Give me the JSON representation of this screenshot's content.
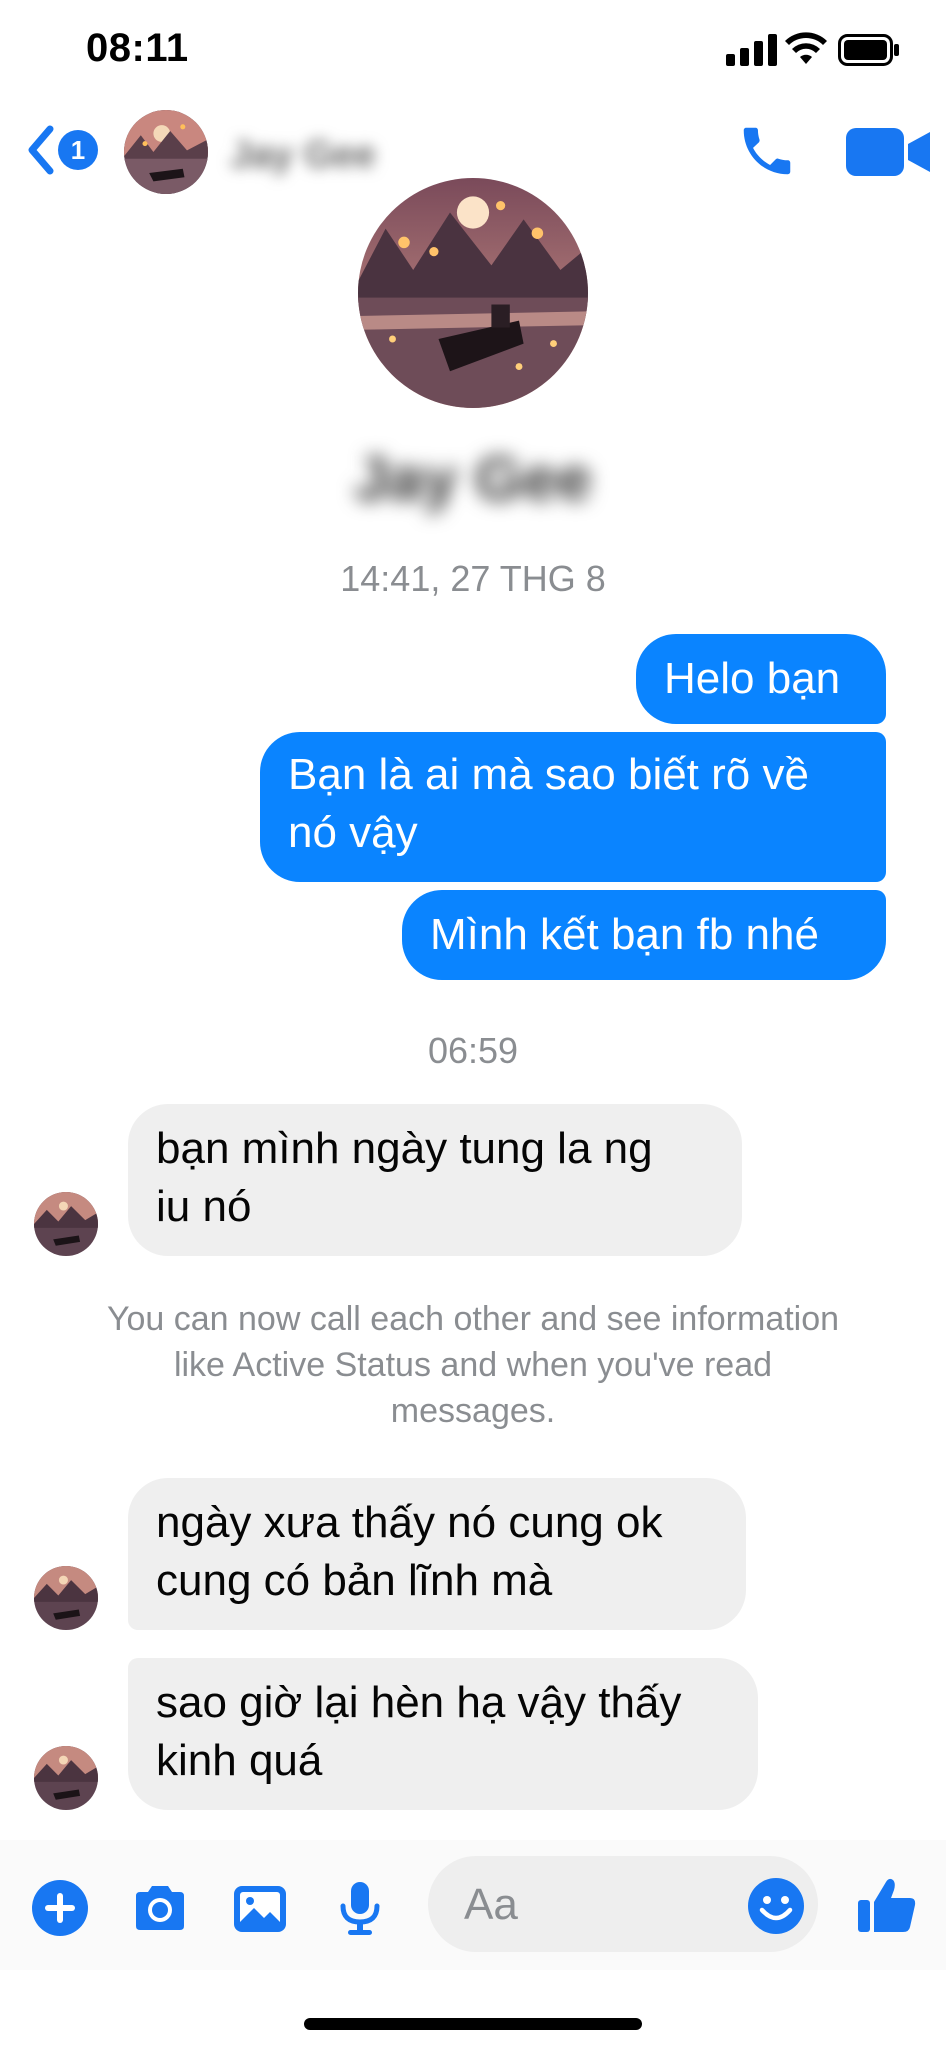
{
  "status_bar": {
    "time": "08:11"
  },
  "header": {
    "back_badge": "1",
    "contact_name": "Jay Gee"
  },
  "profile": {
    "name": "Jay Gee"
  },
  "timestamps": {
    "first": "14:41, 27 THG 8",
    "second": "06:59"
  },
  "messages": {
    "out_1": "Helo bạn",
    "out_2_line1": "Bạn là ai mà sao biết rõ về",
    "out_2_line2": "nó vậy",
    "out_3": "Mình kết bạn fb nhé",
    "in_1_line1": "bạn mình ngày tung la ng",
    "in_1_line2": "iu nó",
    "in_2_line1": "ngày xưa thấy nó cung ok",
    "in_2_line2": "cung có bản lĩnh mà",
    "in_3_line1": "sao giờ lại hèn hạ vậy thấy",
    "in_3_line2": "kinh quá"
  },
  "system_note": {
    "line1": "You can now call each other and see information",
    "line2": "like Active Status and when you've read",
    "line3": "messages."
  },
  "composer": {
    "placeholder": "Aa"
  },
  "colors": {
    "accent": "#0a84ff",
    "brand": "#1877f2",
    "incoming_bubble": "#efefef"
  },
  "icons": [
    "back-chevron-icon",
    "phone-icon",
    "video-camera-icon",
    "plus-icon",
    "camera-icon",
    "photo-icon",
    "microphone-icon",
    "emoji-icon",
    "thumbs-up-icon"
  ]
}
